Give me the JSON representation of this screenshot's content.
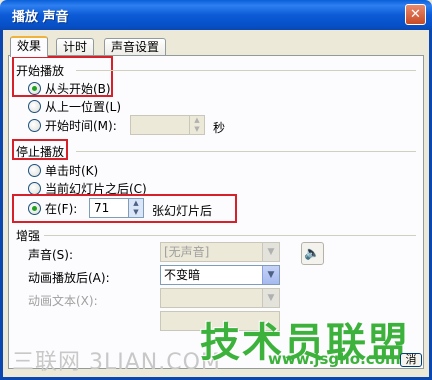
{
  "window": {
    "title": "播放 声音",
    "close_glyph": "✕"
  },
  "tabs": [
    {
      "label": "效果",
      "active": true
    },
    {
      "label": "计时",
      "active": false
    },
    {
      "label": "声音设置",
      "active": false
    }
  ],
  "start": {
    "heading": "开始播放",
    "options": [
      "从头开始(B)",
      "从上一位置(L)",
      "开始时间(M):"
    ],
    "selected": 0,
    "time_value": "",
    "unit": "秒"
  },
  "stop": {
    "heading": "停止播放",
    "options": [
      "单击时(K)",
      "当前幻灯片之后(C)",
      "在(F):"
    ],
    "selected": 2,
    "slides_value": "71",
    "slides_suffix": "张幻灯片后"
  },
  "enhance": {
    "heading": "增强",
    "sound_label": "声音(S):",
    "sound_value": "[无声音]",
    "after_anim_label": "动画播放后(A):",
    "after_anim_value": "不变暗",
    "anim_text_label": "动画文本(X):",
    "anim_text_value": ""
  },
  "watermark": {
    "left_text": "三联网 3LIAN.COM",
    "logo_text": "技术员联盟",
    "url_text": "www.jsgho.com",
    "cancel_fragment": "消"
  },
  "colors": {
    "title_bar": "#0a5fd8",
    "highlight_box": "#d6202a",
    "dialog_bg": "#ece9d8",
    "watermark_green": "#3cb23c"
  }
}
